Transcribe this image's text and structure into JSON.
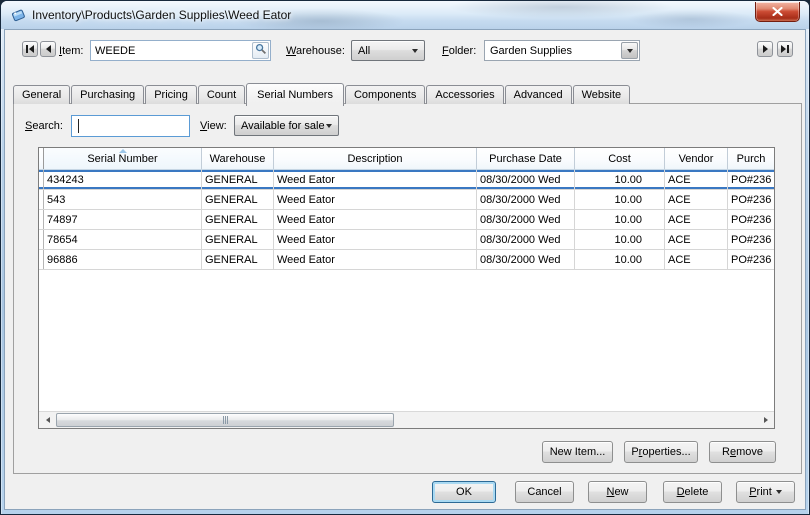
{
  "window": {
    "title": "Inventory\\Products\\Garden Supplies\\Weed Eator"
  },
  "toolbar": {
    "item_label": {
      "key": "I",
      "post": "tem:"
    },
    "item_value": "WEEDE",
    "warehouse_label": {
      "key": "W",
      "post": "arehouse:"
    },
    "warehouse_value": "All",
    "folder_label": {
      "key": "F",
      "post": "older:"
    },
    "folder_value": "Garden Supplies"
  },
  "tabs": [
    "General",
    "Purchasing",
    "Pricing",
    "Count",
    "Serial Numbers",
    "Components",
    "Accessories",
    "Advanced",
    "Website"
  ],
  "active_tab": "Serial Numbers",
  "serial_tab": {
    "search_label": {
      "key": "S",
      "post": "earch:"
    },
    "search_value": "",
    "view_label": {
      "key": "V",
      "post": "iew:"
    },
    "view_value": "Available for sale",
    "table": {
      "columns": [
        "Serial Number",
        "Warehouse",
        "Description",
        "Purchase Date",
        "Cost",
        "Vendor",
        "Purch"
      ],
      "sort_column": "Serial Number",
      "selected_row": 0,
      "rows": [
        [
          "434243",
          "GENERAL",
          "Weed Eator",
          "08/30/2000 Wed",
          "10.00",
          "ACE",
          "PO#236"
        ],
        [
          "543",
          "GENERAL",
          "Weed Eator",
          "08/30/2000 Wed",
          "10.00",
          "ACE",
          "PO#236"
        ],
        [
          "74897",
          "GENERAL",
          "Weed Eator",
          "08/30/2000 Wed",
          "10.00",
          "ACE",
          "PO#236"
        ],
        [
          "78654",
          "GENERAL",
          "Weed Eator",
          "08/30/2000 Wed",
          "10.00",
          "ACE",
          "PO#236"
        ],
        [
          "96886",
          "GENERAL",
          "Weed Eator",
          "08/30/2000 Wed",
          "10.00",
          "ACE",
          "PO#236"
        ]
      ]
    },
    "buttons": {
      "new_item": "New Item...",
      "properties": {
        "pre": "P",
        "key": "r",
        "post": "operties..."
      },
      "remove": {
        "pre": "R",
        "key": "e",
        "post": "move"
      }
    }
  },
  "footer": {
    "ok": "OK",
    "cancel": "Cancel",
    "new": {
      "key": "N",
      "post": "ew"
    },
    "delete": {
      "key": "D",
      "post": "elete"
    },
    "print": {
      "key": "P",
      "post": "rint"
    }
  }
}
